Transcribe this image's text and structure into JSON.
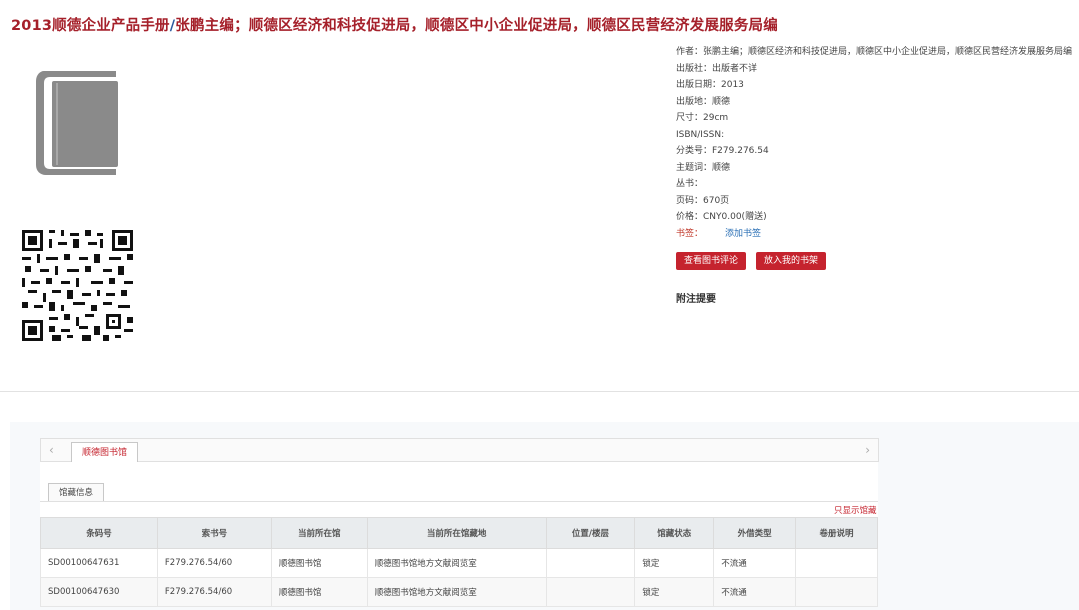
{
  "header": {
    "title_part1": "2013顺德企业产品手册",
    "title_slash": "/",
    "title_part2": "张鹏主编；顺德区经济和科技促进局，顺德区中小企业促进局，顺德区民营经济发展服务局编"
  },
  "meta": {
    "author": "作者：张鹏主编；顺德区经济和科技促进局，顺德区中小企业促进局，顺德区民营经济发展服务局编",
    "publisher": "出版社：出版者不详",
    "pub_date": "出版日期：2013",
    "pub_place": "出版地：顺德",
    "size": "尺寸：29cm",
    "isbn": "ISBN/ISSN:",
    "class_no": "分类号：F279.276.54",
    "subject": "主题词：顺德",
    "series": "丛书：",
    "pages": "页码：670页",
    "price": "价格：CNY0.00(赠送)",
    "tag_label": "书签：",
    "tag_link": "添加书签"
  },
  "buttons": {
    "view_reviews": "查看图书评论",
    "add_shelf": "放入我的书架"
  },
  "notes_title": "附注提要",
  "tabs": {
    "prev_arrow": "‹",
    "next_arrow": "›",
    "active": "顺德图书馆",
    "subtab": "馆藏信息",
    "only_show": "只显示馆藏"
  },
  "table": {
    "headers": [
      "条码号",
      "索书号",
      "当前所在馆",
      "当前所在馆藏地",
      "位置/楼层",
      "馆藏状态",
      "外借类型",
      "卷册说明"
    ],
    "rows": [
      [
        "SD00100647631",
        "F279.276.54/60",
        "顺德图书馆",
        "顺德图书馆地方文献阅览室",
        "",
        "锁定",
        "不流通",
        ""
      ],
      [
        "SD00100647630",
        "F279.276.54/60",
        "顺德图书馆",
        "顺德图书馆地方文献阅览室",
        "",
        "锁定",
        "不流通",
        ""
      ]
    ]
  },
  "colors": {
    "accent": "#c5232e",
    "title": "#a5202a",
    "link": "#2a6fb5"
  },
  "icons": [
    "book-icon",
    "qr-code-icon"
  ]
}
